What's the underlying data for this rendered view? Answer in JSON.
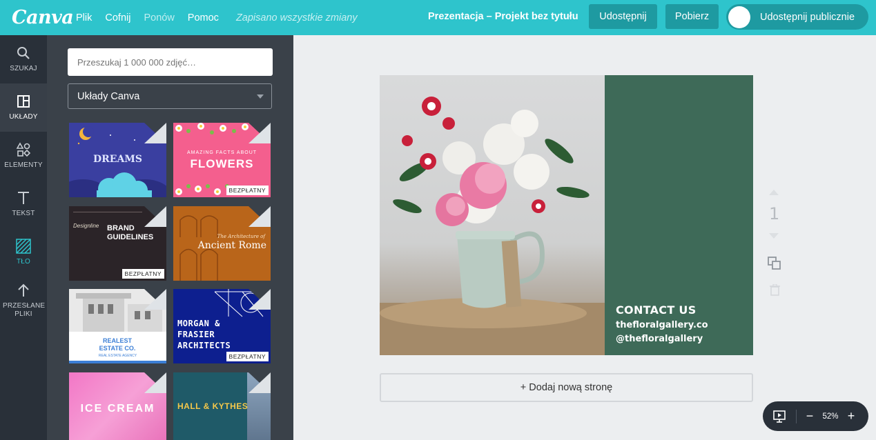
{
  "topbar": {
    "logo": "Canva",
    "menu": [
      {
        "label": "Plik",
        "enabled": true
      },
      {
        "label": "Cofnij",
        "enabled": true
      },
      {
        "label": "Ponów",
        "enabled": false
      },
      {
        "label": "Pomoc",
        "enabled": true
      }
    ],
    "save_status": "Zapisano wszystkie zmiany",
    "doc_title": "Prezentacja – Projekt bez tytułu",
    "share_label": "Udostępnij",
    "download_label": "Pobierz",
    "publish_label": "Udostępnij publicznie",
    "accent_color": "#2ec4cc"
  },
  "leftnav": {
    "items": [
      {
        "label": "SZUKAJ",
        "icon": "search-icon"
      },
      {
        "label": "UKŁADY",
        "icon": "layouts-icon"
      },
      {
        "label": "ELEMENTY",
        "icon": "elements-icon"
      },
      {
        "label": "TEKST",
        "icon": "text-icon"
      },
      {
        "label": "TŁO",
        "icon": "background-icon"
      },
      {
        "label": "PRZESŁANE PLIKI",
        "icon": "upload-icon"
      }
    ]
  },
  "panel": {
    "search_placeholder": "Przeszukaj 1 000 000 zdjęć…",
    "select_value": "Układy Canva",
    "templates": [
      {
        "title": "DREAMS",
        "free": false
      },
      {
        "title": "FLOWERS",
        "subtitle": "AMAZING FACTS ABOUT",
        "free": true
      },
      {
        "title": "BRAND GUIDELINES",
        "subtitle": "Designline",
        "free": true
      },
      {
        "title": "Ancient Rome",
        "subtitle": "The Architecture of",
        "free": false
      },
      {
        "title": "REALEST ESTATE CO.",
        "subtitle": "REAL ESTATE AGENCY",
        "free": false
      },
      {
        "title": "MORGAN & FRASIER ARCHITECTS",
        "free": true
      },
      {
        "title": "ICE CREAM",
        "free": false
      },
      {
        "title": "HALL & KYTHES",
        "free": false
      }
    ],
    "free_label": "BEZPŁATNY"
  },
  "design": {
    "contact_heading": "CONTACT US",
    "website": "thefloralgallery.co",
    "handle": "@thefloralgallery",
    "panel_color": "#3e6a58"
  },
  "page_number": "1",
  "add_page_label": "+ Dodaj nową stronę",
  "zoom": "52%"
}
